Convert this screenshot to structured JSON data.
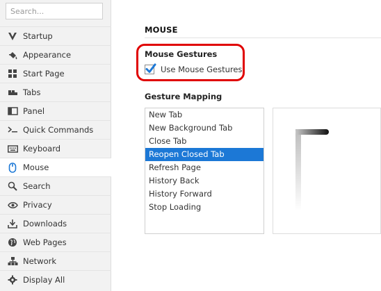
{
  "search": {
    "placeholder": "Search..."
  },
  "sidebar": {
    "items": [
      {
        "label": "Startup",
        "icon": "vivaldi-logo-icon"
      },
      {
        "label": "Appearance",
        "icon": "paint-bucket-icon"
      },
      {
        "label": "Start Page",
        "icon": "grid-icon"
      },
      {
        "label": "Tabs",
        "icon": "tabs-icon"
      },
      {
        "label": "Panel",
        "icon": "panel-icon"
      },
      {
        "label": "Quick Commands",
        "icon": "command-prompt-icon"
      },
      {
        "label": "Keyboard",
        "icon": "keyboard-icon"
      },
      {
        "label": "Mouse",
        "icon": "mouse-icon"
      },
      {
        "label": "Search",
        "icon": "search-icon"
      },
      {
        "label": "Privacy",
        "icon": "eye-icon"
      },
      {
        "label": "Downloads",
        "icon": "download-icon"
      },
      {
        "label": "Web Pages",
        "icon": "globe-icon"
      },
      {
        "label": "Network",
        "icon": "network-icon"
      },
      {
        "label": "Display All",
        "icon": "gear-icon"
      }
    ],
    "active": "Mouse"
  },
  "main": {
    "section_title": "MOUSE",
    "mouse_gestures": {
      "title": "Mouse Gestures",
      "checkbox_label": "Use Mouse Gestures",
      "checked": true
    },
    "gesture_mapping": {
      "title": "Gesture Mapping",
      "items": [
        "New Tab",
        "New Background Tab",
        "Close Tab",
        "Reopen Closed Tab",
        "Refresh Page",
        "History Back",
        "History Forward",
        "Stop Loading"
      ],
      "selected": "Reopen Closed Tab"
    }
  },
  "colors": {
    "accent": "#1c78d6",
    "highlight_ring": "#e00000",
    "icon": "#444444",
    "active_mouse_icon": "#1c78d6"
  }
}
